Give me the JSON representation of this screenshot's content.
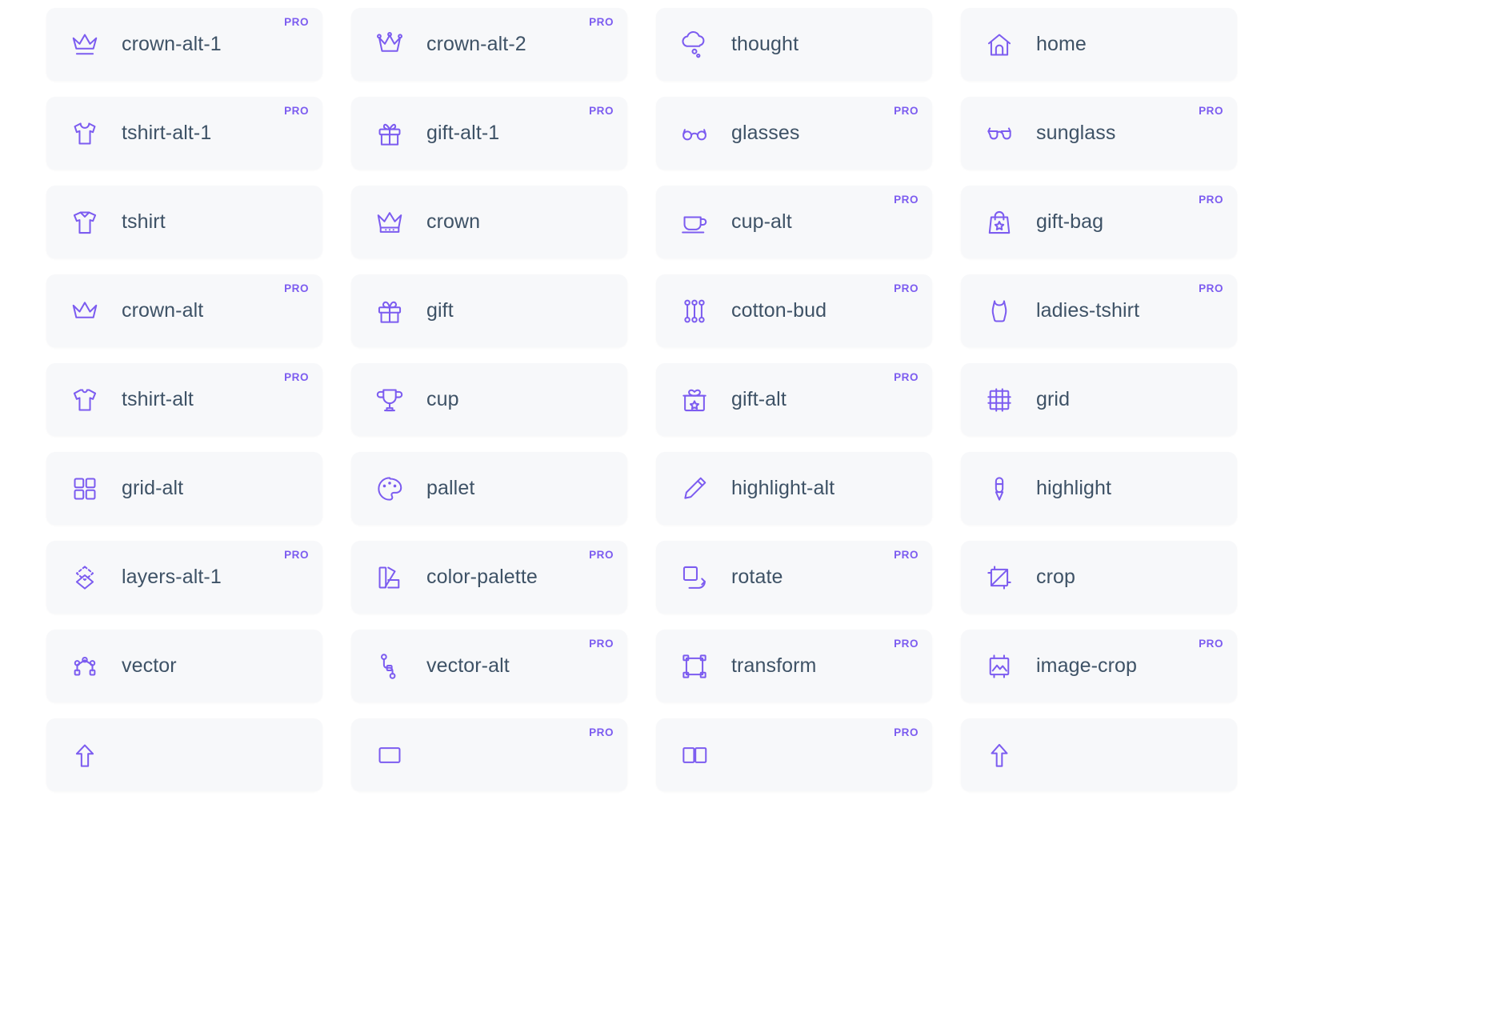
{
  "page": {
    "background": "#ffffff",
    "card_background": "#f7f8fa",
    "accent_color": "#7c5cf0",
    "label_color": "#3e5266",
    "pro_label": "PRO",
    "columns": 4
  },
  "icons": [
    {
      "name": "crown-alt-1",
      "icon": "crown-alt-1-icon",
      "pro": true
    },
    {
      "name": "crown-alt-2",
      "icon": "crown-alt-2-icon",
      "pro": true
    },
    {
      "name": "thought",
      "icon": "thought-icon",
      "pro": false
    },
    {
      "name": "home",
      "icon": "home-icon",
      "pro": false
    },
    {
      "name": "tshirt-alt-1",
      "icon": "tshirt-alt-1-icon",
      "pro": true
    },
    {
      "name": "gift-alt-1",
      "icon": "gift-alt-1-icon",
      "pro": true
    },
    {
      "name": "glasses",
      "icon": "glasses-icon",
      "pro": true
    },
    {
      "name": "sunglass",
      "icon": "sunglass-icon",
      "pro": true
    },
    {
      "name": "tshirt",
      "icon": "tshirt-icon",
      "pro": false
    },
    {
      "name": "crown",
      "icon": "crown-icon",
      "pro": false
    },
    {
      "name": "cup-alt",
      "icon": "cup-alt-icon",
      "pro": true
    },
    {
      "name": "gift-bag",
      "icon": "gift-bag-icon",
      "pro": true
    },
    {
      "name": "crown-alt",
      "icon": "crown-alt-icon",
      "pro": true
    },
    {
      "name": "gift",
      "icon": "gift-icon",
      "pro": false
    },
    {
      "name": "cotton-bud",
      "icon": "cotton-bud-icon",
      "pro": true
    },
    {
      "name": "ladies-tshirt",
      "icon": "ladies-tshirt-icon",
      "pro": true
    },
    {
      "name": "tshirt-alt",
      "icon": "tshirt-alt-icon",
      "pro": true
    },
    {
      "name": "cup",
      "icon": "cup-icon",
      "pro": false
    },
    {
      "name": "gift-alt",
      "icon": "gift-alt-icon",
      "pro": true
    },
    {
      "name": "grid",
      "icon": "grid-icon",
      "pro": false
    },
    {
      "name": "grid-alt",
      "icon": "grid-alt-icon",
      "pro": false
    },
    {
      "name": "pallet",
      "icon": "pallet-icon",
      "pro": false
    },
    {
      "name": "highlight-alt",
      "icon": "highlight-alt-icon",
      "pro": false
    },
    {
      "name": "highlight",
      "icon": "highlight-icon",
      "pro": false
    },
    {
      "name": "layers-alt-1",
      "icon": "layers-alt-1-icon",
      "pro": true
    },
    {
      "name": "color-palette",
      "icon": "color-palette-icon",
      "pro": true
    },
    {
      "name": "rotate",
      "icon": "rotate-icon",
      "pro": true
    },
    {
      "name": "crop",
      "icon": "crop-icon",
      "pro": false
    },
    {
      "name": "vector",
      "icon": "vector-icon",
      "pro": false
    },
    {
      "name": "vector-alt",
      "icon": "vector-alt-icon",
      "pro": true
    },
    {
      "name": "transform",
      "icon": "transform-icon",
      "pro": true
    },
    {
      "name": "image-crop",
      "icon": "image-crop-icon",
      "pro": true
    },
    {
      "name": "",
      "icon": "arrow-up-icon",
      "pro": false
    },
    {
      "name": "",
      "icon": "rectangle-icon",
      "pro": true
    },
    {
      "name": "",
      "icon": "duplicate-icon",
      "pro": true
    },
    {
      "name": "",
      "icon": "arrow-up-alt-icon",
      "pro": false
    }
  ]
}
